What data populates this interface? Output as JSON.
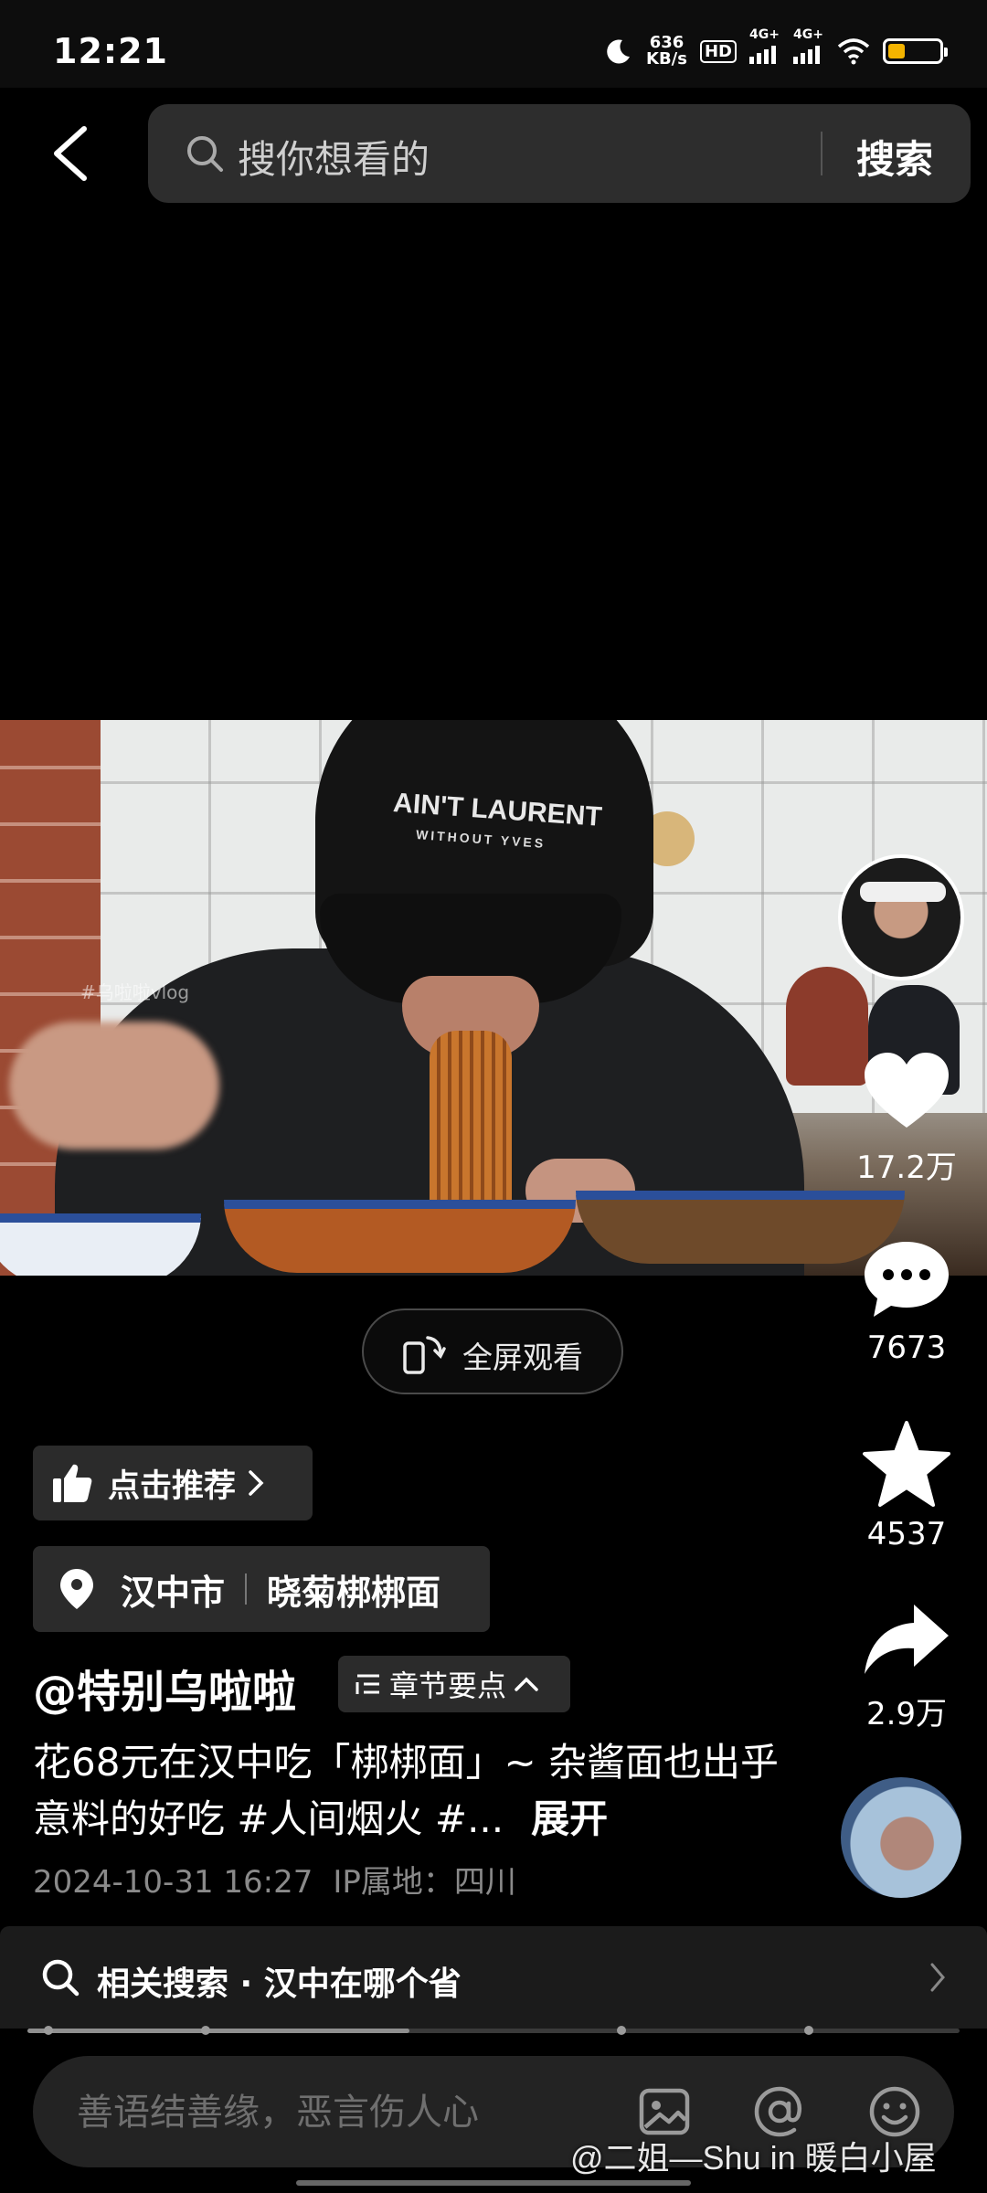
{
  "status_bar": {
    "time": "12:21",
    "net_speed_value": "636",
    "net_speed_unit": "KB/s",
    "hd_label": "HD",
    "sim1_label": "4G+",
    "sim2_label": "4G+",
    "battery_level": 0.33,
    "battery_color": "#f4b400"
  },
  "search": {
    "placeholder": "搜你想看的",
    "button_label": "搜索"
  },
  "video": {
    "cap_text": "AIN'T LAURENT",
    "cap_subtext": "WITHOUT YVES",
    "overlay_watermark": "#乌啦啦vlog",
    "fullscreen_label": "全屏观看"
  },
  "rail": {
    "likes": "17.2万",
    "comments": "7673",
    "favorites": "4537",
    "shares": "2.9万"
  },
  "info": {
    "recommend_label": "点击推荐",
    "location_city": "汉中市",
    "location_shop": "晓菊梆梆面",
    "author": "@特别乌啦啦",
    "chapter_label": "章节要点",
    "description": "花68元在汉中吃「梆梆面」~ 杂酱面也出乎意料的好吃 #人间烟火 #...",
    "expand_label": "展开",
    "timestamp": "2024-10-31 16:27",
    "ip_location": "IP属地：四川"
  },
  "related": {
    "label": "相关搜索 · 汉中在哪个省"
  },
  "progress": {
    "played_fraction": 0.41
  },
  "comment_bar": {
    "placeholder": "善语结善缘，恶言伤人心"
  },
  "screen_watermark": "@二姐—Shu in 暖白小屋",
  "colors": {
    "background": "#000000",
    "chip_bg": "#2b2b2b",
    "meta_text": "#8a8a8a",
    "battery": "#f4b400"
  },
  "icons": [
    "back-arrow-icon",
    "search-icon",
    "rotate-phone-icon",
    "heart-icon",
    "comment-bubble-icon",
    "star-icon",
    "share-arrow-icon",
    "thumbs-up-icon",
    "chevron-right-icon",
    "location-pin-icon",
    "chapter-list-icon",
    "chevron-up-icon",
    "image-icon",
    "at-icon",
    "emoji-icon",
    "moon-icon",
    "wifi-icon"
  ]
}
